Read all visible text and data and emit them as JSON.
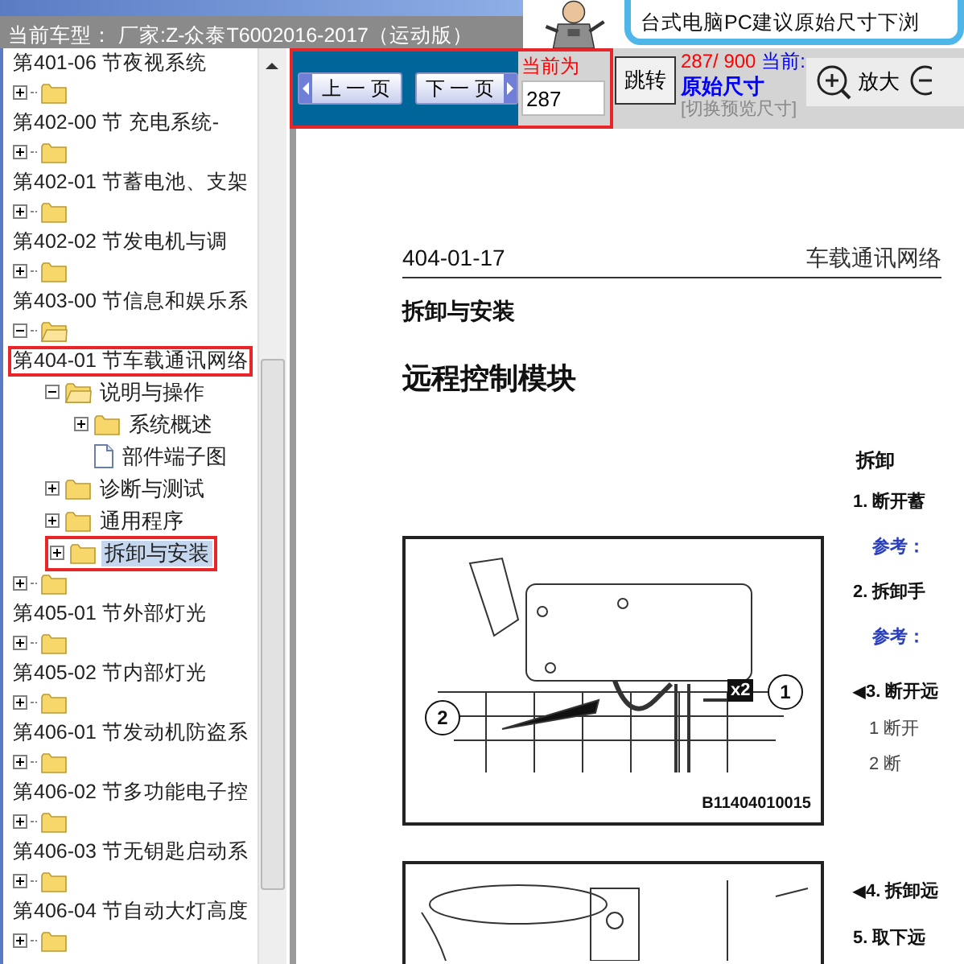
{
  "header": {
    "title": "当前车型： 厂家:Z-众泰T6002016-2017（运动版）",
    "tip": "台式电脑PC建议原始尺寸下浏"
  },
  "tree": [
    {
      "kind": "tail",
      "label": "第401-06 节夜视系统"
    },
    {
      "kind": "node",
      "label": "第402-00 节 充电系统-",
      "expanded": false,
      "highlighted": false
    },
    {
      "kind": "node",
      "label": "第402-01 节蓄电池、支架",
      "expanded": false,
      "highlighted": false
    },
    {
      "kind": "node",
      "label": "第402-02 节发电机与调",
      "expanded": false,
      "highlighted": false
    },
    {
      "kind": "node",
      "label": "第403-00 节信息和娱乐系",
      "expanded": false,
      "highlighted": false
    },
    {
      "kind": "node",
      "label": "第404-01 节车载通讯网络",
      "expanded": true,
      "highlighted": true,
      "children": [
        {
          "kind": "folder",
          "label": "说明与操作",
          "expanded": true,
          "selected": false,
          "children": [
            {
              "kind": "folder",
              "label": "系统概述",
              "expanded": false,
              "selected": false
            },
            {
              "kind": "page",
              "label": "部件端子图",
              "selected": false
            }
          ]
        },
        {
          "kind": "folder",
          "label": "诊断与测试",
          "expanded": false,
          "selected": false
        },
        {
          "kind": "folder",
          "label": "通用程序",
          "expanded": false,
          "selected": false
        },
        {
          "kind": "folder",
          "label": "拆卸与安装",
          "expanded": false,
          "selected": true,
          "highlighted": true
        }
      ]
    },
    {
      "kind": "node",
      "label": "第405-01 节外部灯光",
      "expanded": false,
      "highlighted": false
    },
    {
      "kind": "node",
      "label": "第405-02 节内部灯光",
      "expanded": false,
      "highlighted": false
    },
    {
      "kind": "node",
      "label": "第406-01 节发动机防盗系",
      "expanded": false,
      "highlighted": false
    },
    {
      "kind": "node",
      "label": "第406-02 节多功能电子控",
      "expanded": false,
      "highlighted": false
    },
    {
      "kind": "node",
      "label": "第406-03 节无钥匙启动系",
      "expanded": false,
      "highlighted": false
    },
    {
      "kind": "node",
      "label": "第406-04 节自动大灯高度",
      "expanded": false,
      "highlighted": false
    },
    {
      "kind": "head",
      "expanded": false
    }
  ],
  "toolbar": {
    "highlighted": true,
    "prev": "上 一 页",
    "next": "下 一 页",
    "page_label": "当前为",
    "page_value": "287",
    "go": "跳转",
    "count": "287/ 900",
    "current_label": "当前:",
    "size_mode": "原始尺寸",
    "switch_link": "[切换预览尺寸]",
    "zoom_in": "放大"
  },
  "page": {
    "number": "404-01-17",
    "chapter": "车载通讯网络",
    "section": "拆卸与安装",
    "title": "远程控制模块",
    "heading": "拆卸",
    "blocks": [
      {
        "figure": {
          "callouts": [
            "2",
            "1"
          ],
          "multiplier": "x2",
          "code": "B11404010015"
        },
        "steps": [
          {
            "kind": "step",
            "text": "1. 断开蓄"
          },
          {
            "kind": "ref",
            "text": "参考："
          },
          {
            "kind": "step",
            "text": "2. 拆卸手"
          },
          {
            "kind": "ref",
            "text": "参考："
          },
          {
            "kind": "figstep",
            "marker": "◀",
            "text": "3. 断开远"
          },
          {
            "kind": "sub",
            "text": "1 断开"
          },
          {
            "kind": "sub",
            "text": "2 断"
          }
        ]
      },
      {
        "steps": [
          {
            "kind": "figstep",
            "marker": "◀",
            "text": "4. 拆卸远"
          },
          {
            "kind": "step",
            "text": "5. 取下远"
          }
        ]
      }
    ]
  }
}
